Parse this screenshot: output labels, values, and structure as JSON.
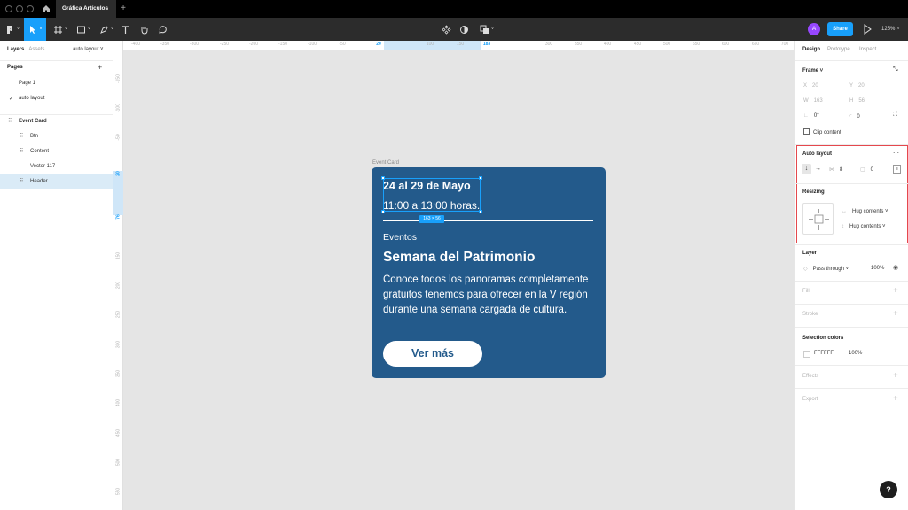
{
  "window": {
    "tab_title": "Gráfica Artículos",
    "new_tab": "+"
  },
  "toolbar": {
    "share_label": "Share",
    "avatar_initial": "A",
    "zoom": "125%"
  },
  "left_panel": {
    "tabs": [
      "Layers",
      "Assets"
    ],
    "current_page": "auto layout ˅",
    "pages_header": "Pages",
    "pages": [
      "Page 1",
      "auto layout"
    ],
    "layers": [
      {
        "name": "Event Card",
        "icon": "frame-grid-icon"
      },
      {
        "name": "Btn",
        "icon": "frame-grid-icon"
      },
      {
        "name": "Content",
        "icon": "frame-grid-icon"
      },
      {
        "name": "Vector 117",
        "icon": "vector-line-icon"
      },
      {
        "name": "Header",
        "icon": "frame-grid-icon"
      }
    ]
  },
  "rulers": {
    "top": [
      "-400",
      "-350",
      "-300",
      "-250",
      "-200",
      "-150",
      "-100",
      "-50",
      "20",
      "100",
      "150",
      "183",
      "300",
      "350",
      "400",
      "450",
      "500",
      "550",
      "600",
      "650",
      "700"
    ],
    "left": [
      "-150",
      "-100",
      "-50",
      "20",
      "76",
      "150",
      "200",
      "250",
      "300",
      "350",
      "400",
      "450",
      "500",
      "550"
    ]
  },
  "canvas": {
    "frame_label": "Event Card",
    "card": {
      "date": "24 al 29 de Mayo",
      "hours": "11:00 a 13:00 horas.",
      "category": "Eventos",
      "title": "Semana del Patrimonio",
      "description": "Conoce todos los panoramas completamente gratuitos tenemos para ofrecer en la V región durante una semana cargada de cultura.",
      "button": "Ver más"
    },
    "selection_size": "163 × 56"
  },
  "right_panel": {
    "tabs": [
      "Design",
      "Prototype",
      "Inspect"
    ],
    "frame": {
      "header": "Frame ˅",
      "x_label": "X",
      "x": "20",
      "y_label": "Y",
      "y": "20",
      "w_label": "W",
      "w": "163",
      "h_label": "H",
      "h": "56",
      "rotation": "0°",
      "radius": "0",
      "clip_content": "Clip content"
    },
    "auto_layout": {
      "header": "Auto layout",
      "spacing": "8",
      "padding": "0",
      "resizing_header": "Resizing",
      "horizontal": "Hug contents ˅",
      "vertical": "Hug contents ˅"
    },
    "layer": {
      "header": "Layer",
      "blend": "Pass through ˅",
      "opacity": "100%"
    },
    "fill": "Fill",
    "stroke": "Stroke",
    "selection_colors": {
      "header": "Selection colors",
      "hex": "FFFFFF",
      "opacity": "100%"
    },
    "effects": "Effects",
    "export": "Export",
    "help": "?"
  }
}
